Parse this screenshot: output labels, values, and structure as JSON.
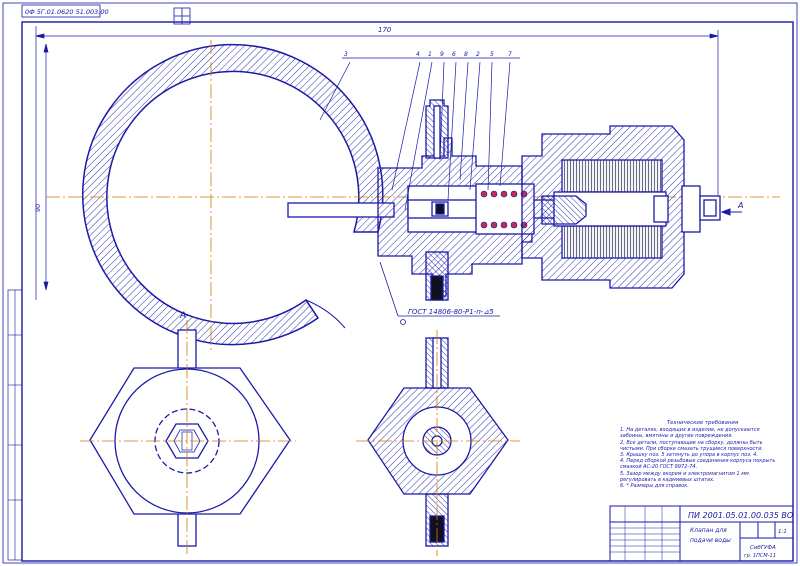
{
  "sheet": {
    "corner_code": "0Ф 5Г.01.0620 51.003.00",
    "top_dimension": "170",
    "left_dimension": "90",
    "gost_note": "ГОСТ 14806-80-Р1-п-⊿5",
    "view_label_left": "А",
    "view_label_arrow": "А",
    "leader_numbers": [
      "3",
      "4",
      "1",
      "9",
      "6",
      "8",
      "2",
      "5",
      "7"
    ]
  },
  "notes": {
    "title": "Технические требования",
    "items": [
      "1. На деталях, входящих в изделие, не допускаются забоины, вмятины и другие повреждения.",
      "2. Все детали, поступающие на сборку, должны быть чистыми. При сборке смазать трущиеся поверхности.",
      "3. Крышку поз. 5 затянуть до упора в корпус поз. 4.",
      "4. Перед сборкой резьбовые соединения корпуса покрыть смазкой АС-20 ГОСТ 9972-74.",
      "5. Зазор между якорем и электромагнитом 1 мм регулировать в кадмиевых штатах.",
      "6. * Размеры для справок."
    ]
  },
  "title_block": {
    "doc_code": "ПИ 2001.05.01.00.035 ВО",
    "name_line1": "Клапан для",
    "name_line2": "подачи воды",
    "scale": "1:1",
    "org_line1": "СибГУФА",
    "org_line2": "гр. 1ПСМ-11"
  },
  "colors": {
    "ink": "#1a1aa8",
    "axis": "#d27a00",
    "paper": "#ffffff",
    "dark": "#101020"
  }
}
